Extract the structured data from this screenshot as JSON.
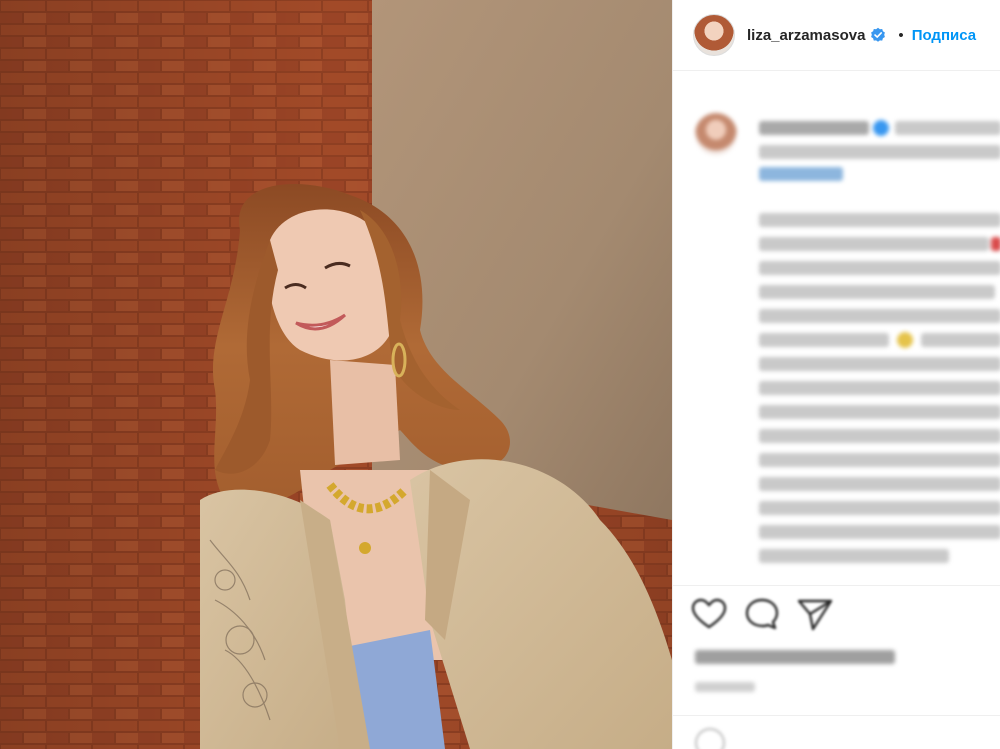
{
  "post": {
    "username": "liza_arzamasova",
    "verified_icon": "verified-badge-icon",
    "separator": "•",
    "follow_label": "Подписа"
  },
  "colors": {
    "link_blue": "#0095f6",
    "verified_blue": "#3897f0",
    "text": "#262626",
    "border": "#efefef"
  },
  "icons": [
    "heart-icon",
    "comment-icon",
    "share-icon",
    "emoji-icon"
  ]
}
